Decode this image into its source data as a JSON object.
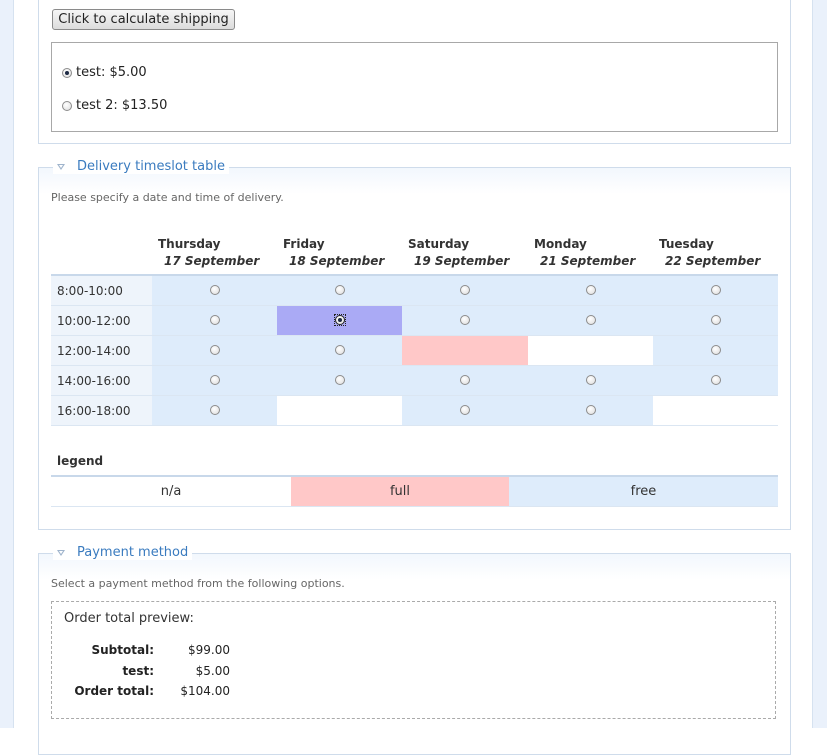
{
  "shipping": {
    "calc_button_label": "Click to calculate shipping",
    "options": [
      {
        "label": "test: $5.00",
        "checked": true
      },
      {
        "label": "test 2: $13.50",
        "checked": false
      }
    ]
  },
  "delivery": {
    "legend": "Delivery timeslot table",
    "description": "Please specify a date and time of delivery.",
    "days": [
      {
        "name": "Thursday",
        "date": "17 September"
      },
      {
        "name": "Friday",
        "date": "18 September"
      },
      {
        "name": "Saturday",
        "date": "19 September"
      },
      {
        "name": "Monday",
        "date": "21 September"
      },
      {
        "name": "Tuesday",
        "date": "22 September"
      }
    ],
    "rows": [
      {
        "time": "8:00-10:00",
        "cells": [
          "free",
          "free",
          "free",
          "free",
          "free"
        ]
      },
      {
        "time": "10:00-12:00",
        "cells": [
          "free",
          "selected",
          "free",
          "free",
          "free"
        ]
      },
      {
        "time": "12:00-14:00",
        "cells": [
          "free",
          "free",
          "full",
          "na",
          "free"
        ]
      },
      {
        "time": "14:00-16:00",
        "cells": [
          "free",
          "free",
          "free",
          "free",
          "free"
        ]
      },
      {
        "time": "16:00-18:00",
        "cells": [
          "free",
          "na",
          "free",
          "free",
          "na"
        ]
      }
    ],
    "legend_title": "legend",
    "legend_items": [
      {
        "label": "n/a",
        "color": "#ffffff"
      },
      {
        "label": "full",
        "color": "#ffc8c8"
      },
      {
        "label": "free",
        "color": "#deecfb"
      }
    ]
  },
  "payment": {
    "legend": "Payment method",
    "description": "Select a payment method from the following options.",
    "preview_title": "Order total preview:",
    "lines": [
      {
        "label": "Subtotal:",
        "value": "$99.00"
      },
      {
        "label": "test:",
        "value": "$5.00"
      },
      {
        "label": "Order total:",
        "value": "$104.00"
      }
    ]
  },
  "colors": {
    "accent": "#3a7bbf",
    "free": "#deecfb",
    "full": "#ffc8c8",
    "selected": "#aaaaf5"
  }
}
